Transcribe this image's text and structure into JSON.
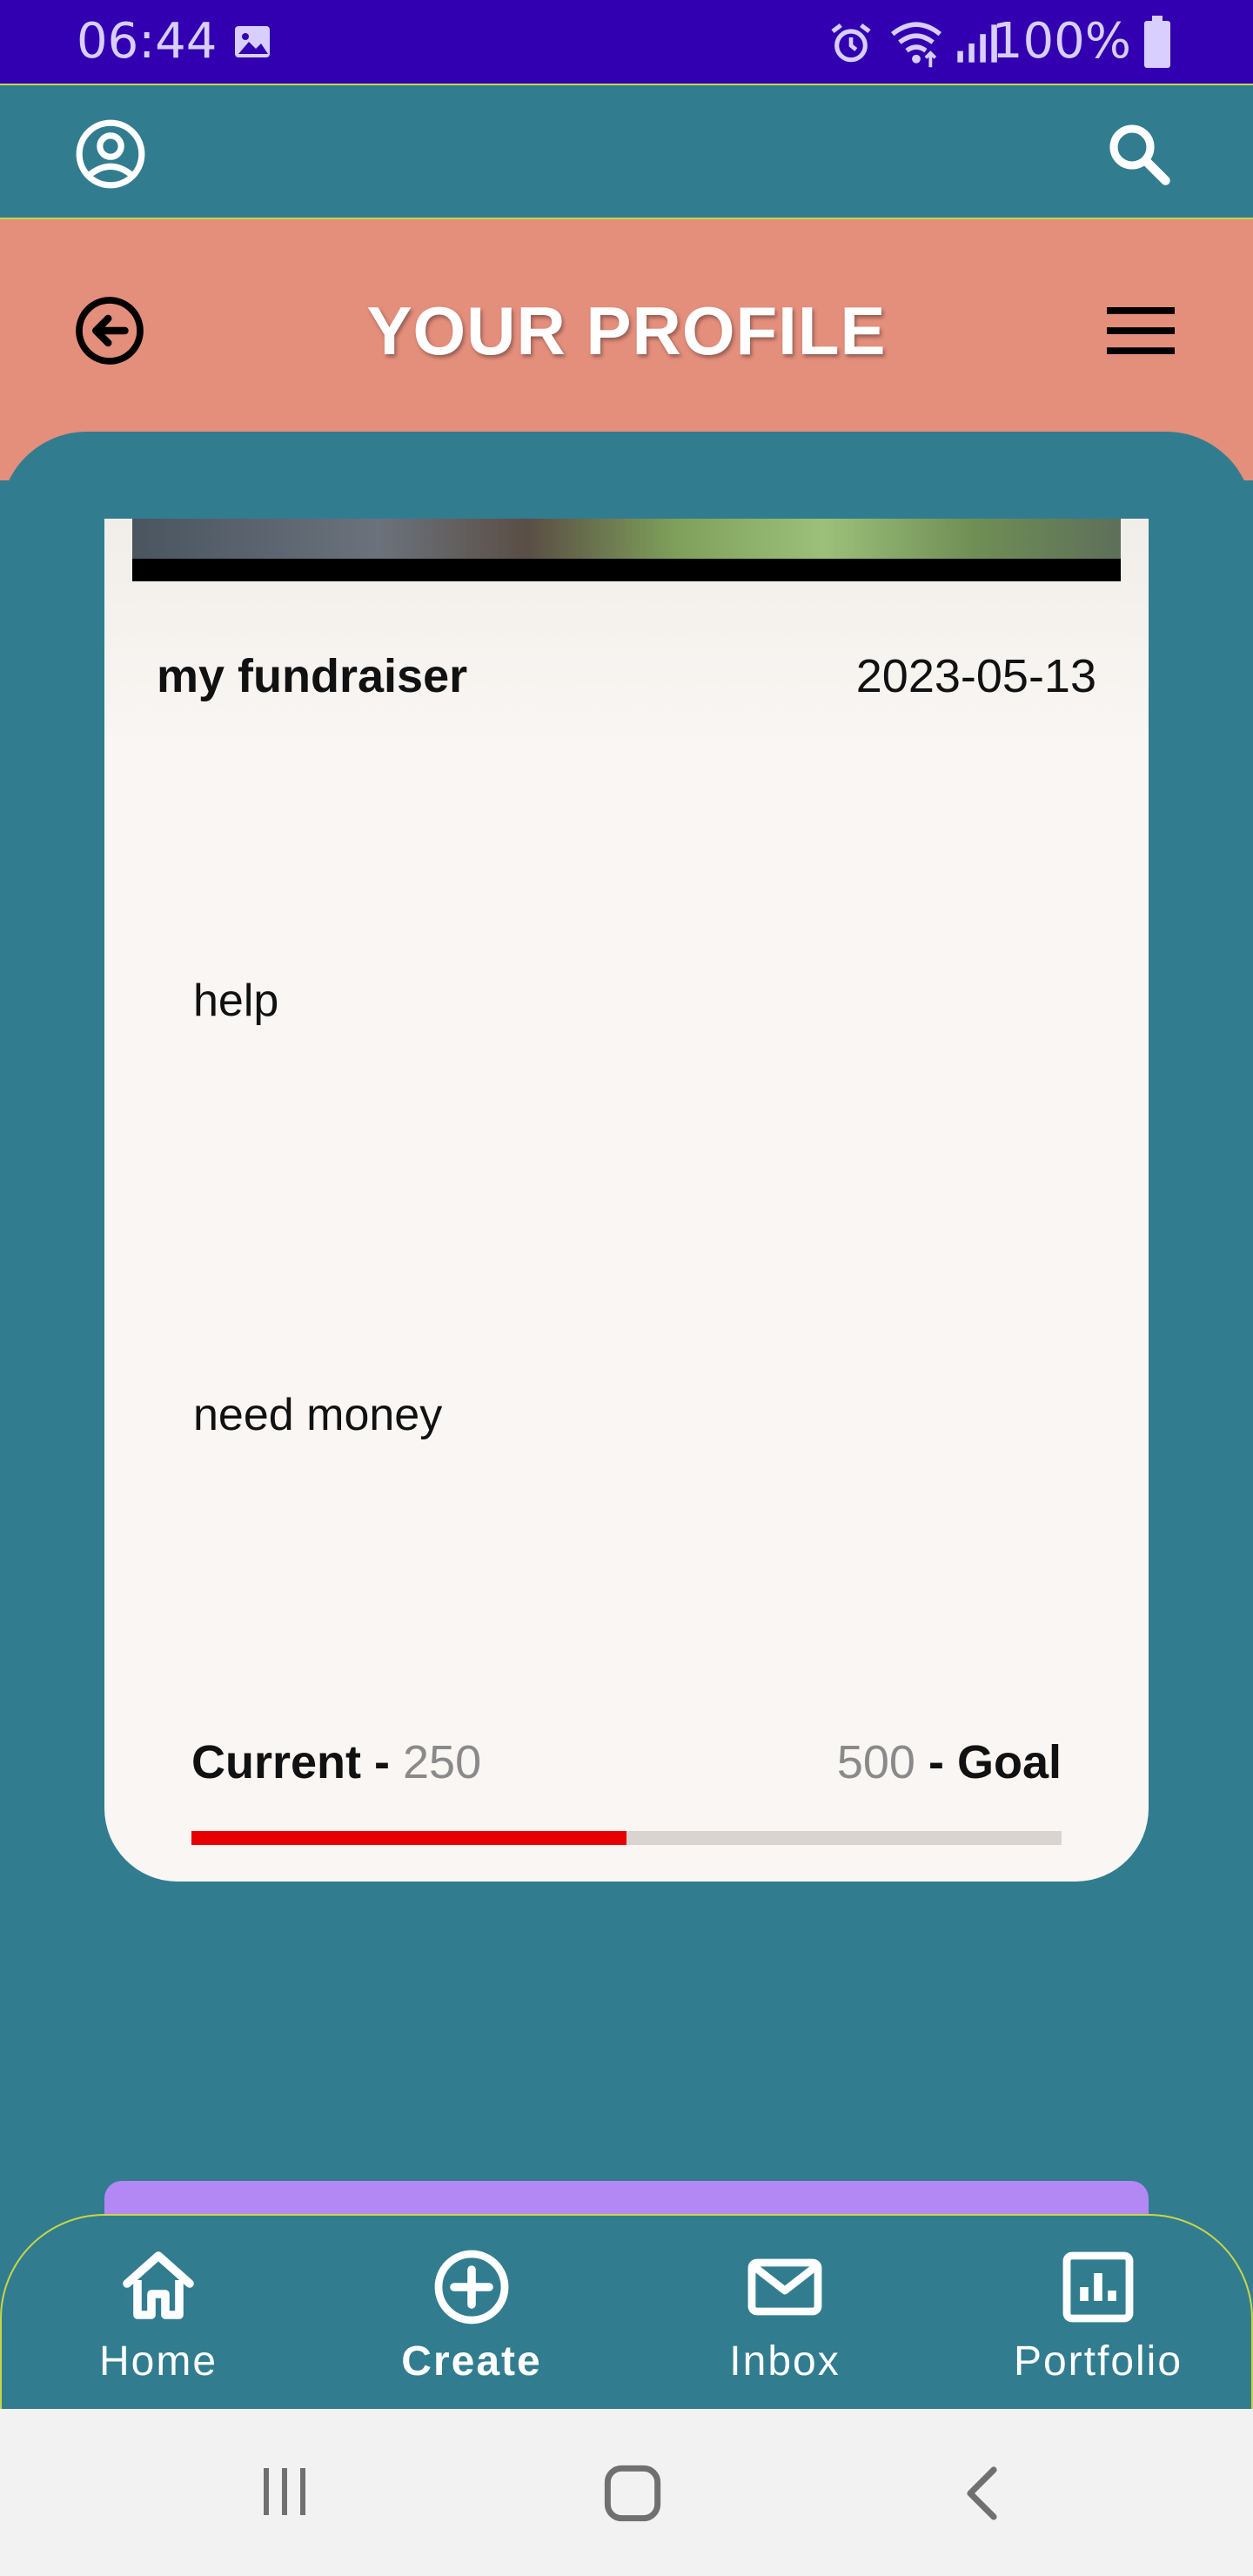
{
  "status_bar": {
    "time": "06:44",
    "battery": "100%"
  },
  "top_bar": {
    "left_icon": "account-circle-icon",
    "right_icon": "search-icon"
  },
  "header": {
    "title": "YOUR PROFILE",
    "back_icon": "back-arrow-circle-icon",
    "menu_icon": "hamburger-menu-icon"
  },
  "fundraiser": {
    "title": "my fundraiser",
    "date": "2023-05-13",
    "description_1": "help",
    "description_2": "need money",
    "current_label": "Current",
    "current_value": "250",
    "goal_value": "500",
    "goal_label": "Goal",
    "separator": " - ",
    "progress_fraction": 0.5
  },
  "bottom_nav": {
    "items": [
      {
        "label": "Home",
        "icon": "home-icon"
      },
      {
        "label": "Create",
        "icon": "add-circle-icon"
      },
      {
        "label": "Inbox",
        "icon": "mail-icon"
      },
      {
        "label": "Portfolio",
        "icon": "bar-chart-icon"
      }
    ]
  },
  "colors": {
    "status_bar": "#3200b0",
    "teal": "#317d8f",
    "header": "#e48e7c",
    "progress": "#e80000",
    "accent_strip": "#b388f5"
  }
}
